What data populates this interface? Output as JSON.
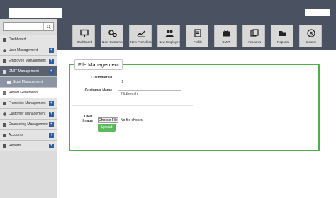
{
  "sidebar": {
    "items": [
      {
        "label": "Dashboard",
        "icon": "dashboard-icon"
      },
      {
        "label": "User Management",
        "icon": "user-icon"
      },
      {
        "label": "Employee Management",
        "icon": "employee-icon"
      },
      {
        "label": "DMIT Management",
        "icon": "dmit-icon"
      },
      {
        "label": "Scan Management",
        "icon": "scan-icon"
      },
      {
        "label": "Report Generation",
        "icon": "report-icon"
      },
      {
        "label": "Franchise Management",
        "icon": "franchise-icon"
      },
      {
        "label": "Customer Management",
        "icon": "customer-icon"
      },
      {
        "label": "Counseling Management",
        "icon": "counseling-icon"
      },
      {
        "label": "Accounts",
        "icon": "accounts-icon"
      },
      {
        "label": "Reports",
        "icon": "reports-icon"
      }
    ],
    "expand_symbol": "+"
  },
  "toolbar": {
    "tiles": [
      {
        "label": "Dashboard",
        "icon": "monitor-icon"
      },
      {
        "label": "New Customer",
        "icon": "gears-icon"
      },
      {
        "label": "New Franchise",
        "icon": "chart-icon"
      },
      {
        "label": "New Employee",
        "icon": "users-icon"
      },
      {
        "label": "Profile",
        "icon": "profile-icon"
      },
      {
        "label": "DMIT",
        "icon": "briefcase-icon"
      },
      {
        "label": "Accounts",
        "icon": "accounts-icon"
      },
      {
        "label": "Reports",
        "icon": "folder-icon"
      },
      {
        "label": "Income",
        "icon": "dollar-icon"
      }
    ]
  },
  "form": {
    "title": "File Management",
    "customer_id_label": "Customer ID",
    "customer_id_value": "1",
    "customer_name_label": "Customer Name",
    "customer_name_value": "Nidheesh",
    "dmit_image_label_1": "DMIT",
    "dmit_image_label_2": "Image",
    "choose_file_label": "Choose File",
    "no_file_text": "No file chosen",
    "upload_label": "Upload"
  },
  "colors": {
    "header_bg": "#4a5160",
    "panel_border": "#4cae4c",
    "upload_bg": "#5cb85c",
    "plus_bg": "#2c5da8"
  }
}
